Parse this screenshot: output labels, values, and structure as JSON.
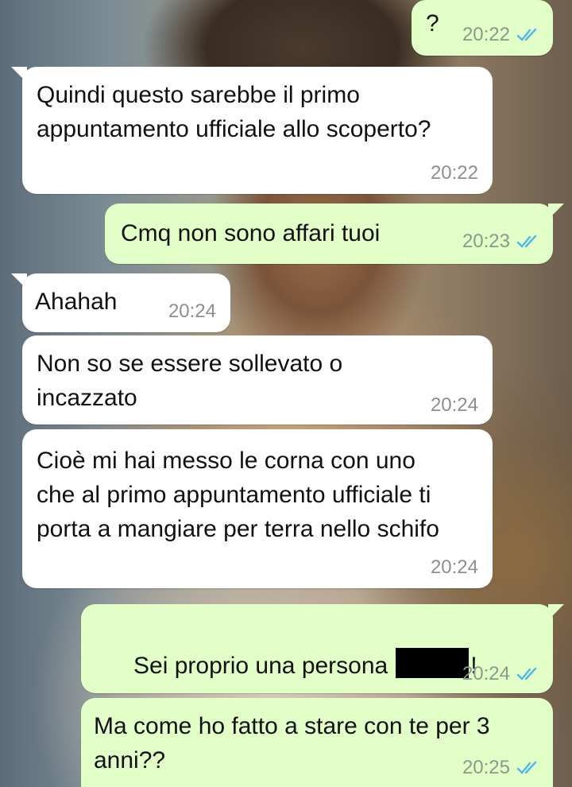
{
  "chat": {
    "messages": [
      {
        "direction": "outgoing",
        "text": "?",
        "time": "20:22",
        "status": "read"
      },
      {
        "direction": "incoming",
        "text": "Quindi questo sarebbe il primo appuntamento ufficiale allo scoperto?",
        "time": "20:22"
      },
      {
        "direction": "outgoing",
        "text": "Cmq non sono affari tuoi",
        "time": "20:23",
        "status": "read"
      },
      {
        "direction": "incoming",
        "text": "Ahahah",
        "time": "20:24"
      },
      {
        "direction": "incoming",
        "text": "Non so se essere sollevato o incazzato",
        "time": "20:24"
      },
      {
        "direction": "incoming",
        "text": "Cioè mi hai messo le corna con uno che al primo appuntamento ufficiale ti porta a mangiare per terra nello schifo",
        "time": "20:24"
      },
      {
        "direction": "outgoing",
        "text_before": "Sei proprio una persona",
        "text_after": "!",
        "redacted": true,
        "time": "20:24",
        "status": "read"
      },
      {
        "direction": "outgoing",
        "text": "Ma come ho fatto a stare con te per 3 anni??",
        "time": "20:25",
        "status": "read"
      }
    ]
  },
  "colors": {
    "incoming_bubble": "#ffffff",
    "outgoing_bubble": "#e2ffc8",
    "read_ticks": "#4fb6ec",
    "timestamp": "#8e8e8e"
  },
  "icons": {
    "read_receipt": "double-check-icon"
  }
}
